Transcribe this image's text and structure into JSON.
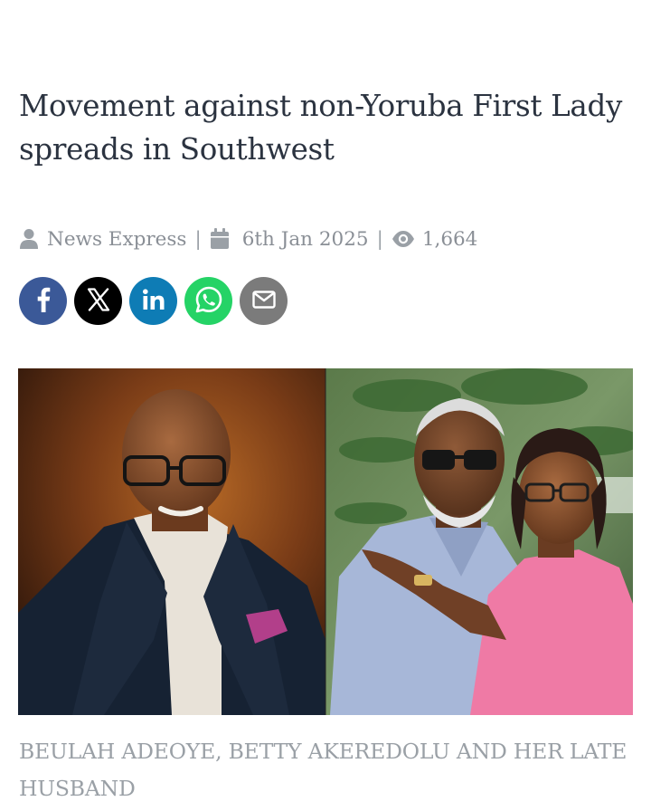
{
  "article": {
    "title": "Movement against non-Yoruba First Lady spreads in Southwest",
    "meta": {
      "author": "News Express",
      "separator": "|",
      "date": "6th Jan 2025",
      "views": "1,664"
    },
    "share": [
      {
        "name": "facebook",
        "color": "#3b5998"
      },
      {
        "name": "x",
        "color": "#000000"
      },
      {
        "name": "linkedin",
        "color": "#0e7cb5"
      },
      {
        "name": "whatsapp",
        "color": "#25d366"
      },
      {
        "name": "email",
        "color": "#7b7b7b"
      }
    ],
    "image_caption": "BEULAH ADEOYE, BETTY AKEREDOLU AND HER LATE HUSBAND"
  },
  "colors": {
    "title": "#2b3340",
    "meta": "#8a8f96",
    "caption": "#9aa0a6"
  }
}
